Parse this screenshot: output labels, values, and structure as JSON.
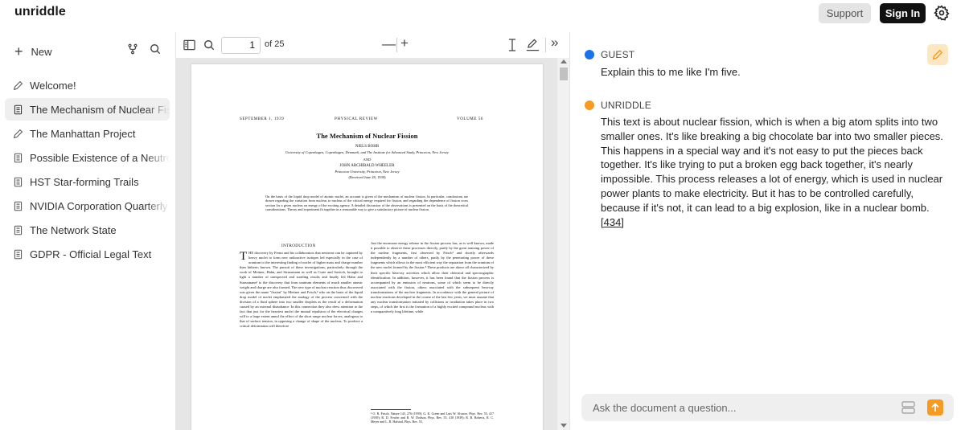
{
  "app": {
    "logo": "unriddle"
  },
  "header": {
    "support_label": "Support",
    "signin_label": "Sign In",
    "settings_icon": "gear-icon"
  },
  "sidebar": {
    "new_label": "New",
    "items": [
      {
        "label": "Welcome!",
        "icon": "pencil-icon"
      },
      {
        "label": "The Mechanism of Nuclear Fission",
        "icon": "document-icon",
        "active": true
      },
      {
        "label": "The Manhattan Project",
        "icon": "pencil-icon"
      },
      {
        "label": "Possible Existence of a Neutron",
        "icon": "document-icon"
      },
      {
        "label": "HST Star-forming Trails",
        "icon": "document-icon"
      },
      {
        "label": "NVIDIA Corporation Quarterly Report",
        "icon": "document-icon"
      },
      {
        "label": "The Network State",
        "icon": "document-icon"
      },
      {
        "label": "GDPR - Official Legal Text",
        "icon": "document-icon"
      }
    ]
  },
  "pdf_toolbar": {
    "page_value": "1",
    "page_of": "of 25",
    "zoom_minus": "—",
    "zoom_plus": "+",
    "expand_label": "»"
  },
  "pdf": {
    "header_left": "SEPTEMBER 1, 1939",
    "header_center": "PHYSICAL REVIEW",
    "header_right": "VOLUME 56",
    "title": "The Mechanism of Nuclear Fission",
    "author1": "NIELS BOHR",
    "affiliation1": "University of Copenhagen, Copenhagen, Denmark, and The Institute for Advanced Study, Princeton, New Jersey",
    "and": "AND",
    "author2": "JOHN ARCHIBALD WHEELER",
    "affiliation2": "Princeton University, Princeton, New Jersey",
    "received": "(Received June 28, 1939)",
    "abstract": "On the basis of the liquid drop model of atomic nuclei, an account is given of the mechanism of nuclear fission. In particular, conclusions are drawn regarding the variation from nucleus to nucleus of the critical energy required for fission, and regarding the dependence of fission cross section for a given nucleus on energy of the exciting agency. A detailed discussion of the observations is presented on the basis of the theoretical considerations. Theory and experiment fit together in a reasonable way to give a satisfactory picture of nuclear fission.",
    "intro_heading": "INTRODUCTION",
    "dropcap": "T",
    "col_left": "HE discovery by Fermi and his collaborators that neutrons can be captured by heavy nuclei to form new radioactive isotopes led especially in the case of uranium to the interesting finding of nuclei of higher mass and charge number than hitherto known. The pursuit of these investigations, particularly through the work of Meitner, Hahn, and Strassmann as well as Curie and Savitch, brought to light a number of unexpected and startling results and finally led Hahn and Strassmann¹ to the discovery that from uranium elements of much smaller atomic weight and charge are also formed. The new type of nuclear reaction thus discovered was given the name \"fission\" by Meitner and Frisch,² who on the basis of the liquid drop model of nuclei emphasized the analogy of the process concerned with the division of a fluid sphere into two smaller droplets as the result of a deformation caused by an external disturbance. In this connection they also drew attention to the fact that just for the heaviest nuclei the mutual repulsion of the electrical charges will to a large extent annul the effect of the short range nuclear forces, analogous to that of surface tension, in opposing a change of shape of the nucleus. To produce a critical deformation will therefore",
    "col_right": "Just the enormous energy release in the fission process has, as is well known, made it possible to observe these processes directly, partly by the great ionizing power of the nuclear fragments, first observed by Frisch³ and shortly afterwards independently by a number of others, partly by the penetrating power of these fragments which allows in the most efficient way the separation from the uranium of the new nuclei formed by the fission.⁴ These products are above all characterized by their specific beta-ray activities which allow their chemical and spectrographic identification. In addition, however, it has been found that the fission process is accompanied by an emission of neutrons, some of which seem to be directly associated with the fission, others associated with the subsequent beta-ray transformations of the nuclear fragments. In accordance with the general picture of nuclear reactions developed in the course of the last few years, we must assume that any nuclear transformation initiated by collisions or irradiation takes place in two steps, of which the first is the formation of a highly excited compound nucleus with a comparatively long lifetime, while",
    "footnote": "¹ O. R. Frisch, Nature 143, 276 (1939); G. K. Green and Luis W. Alvarez, Phys. Rev. 55, 417 (1939); R. D. Fowler and R. W. Dodson, Phys. Rev. 55, 418 (1939); R. B. Roberts, R. C. Meyer and L. R. Hafstad, Phys. Rev. 55,"
  },
  "chat": {
    "messages": [
      {
        "role": "GUEST",
        "color": "#1a73e8",
        "text": "Explain this to me like I'm five."
      },
      {
        "role": "UNRIDDLE",
        "color": "#f59a23",
        "text": "This text is about nuclear fission, which is when a big atom splits into two smaller ones. It's like breaking a big chocolate bar into two smaller pieces. This happens in a special way and it's not easy to put the pieces back together. It's like trying to put a broken egg back together, it's nearly impossible. This process releases a lot of energy, which is used in nuclear power plants to make electricity. But it has to be controlled carefully, because if it's not, it can lead to a big explosion, like in a nuclear bomb.",
        "ref": "[434]"
      }
    ],
    "input_placeholder": "Ask the document a question..."
  },
  "colors": {
    "accent": "#f59a23",
    "guest_dot": "#1a73e8",
    "dark_button": "#111111"
  }
}
